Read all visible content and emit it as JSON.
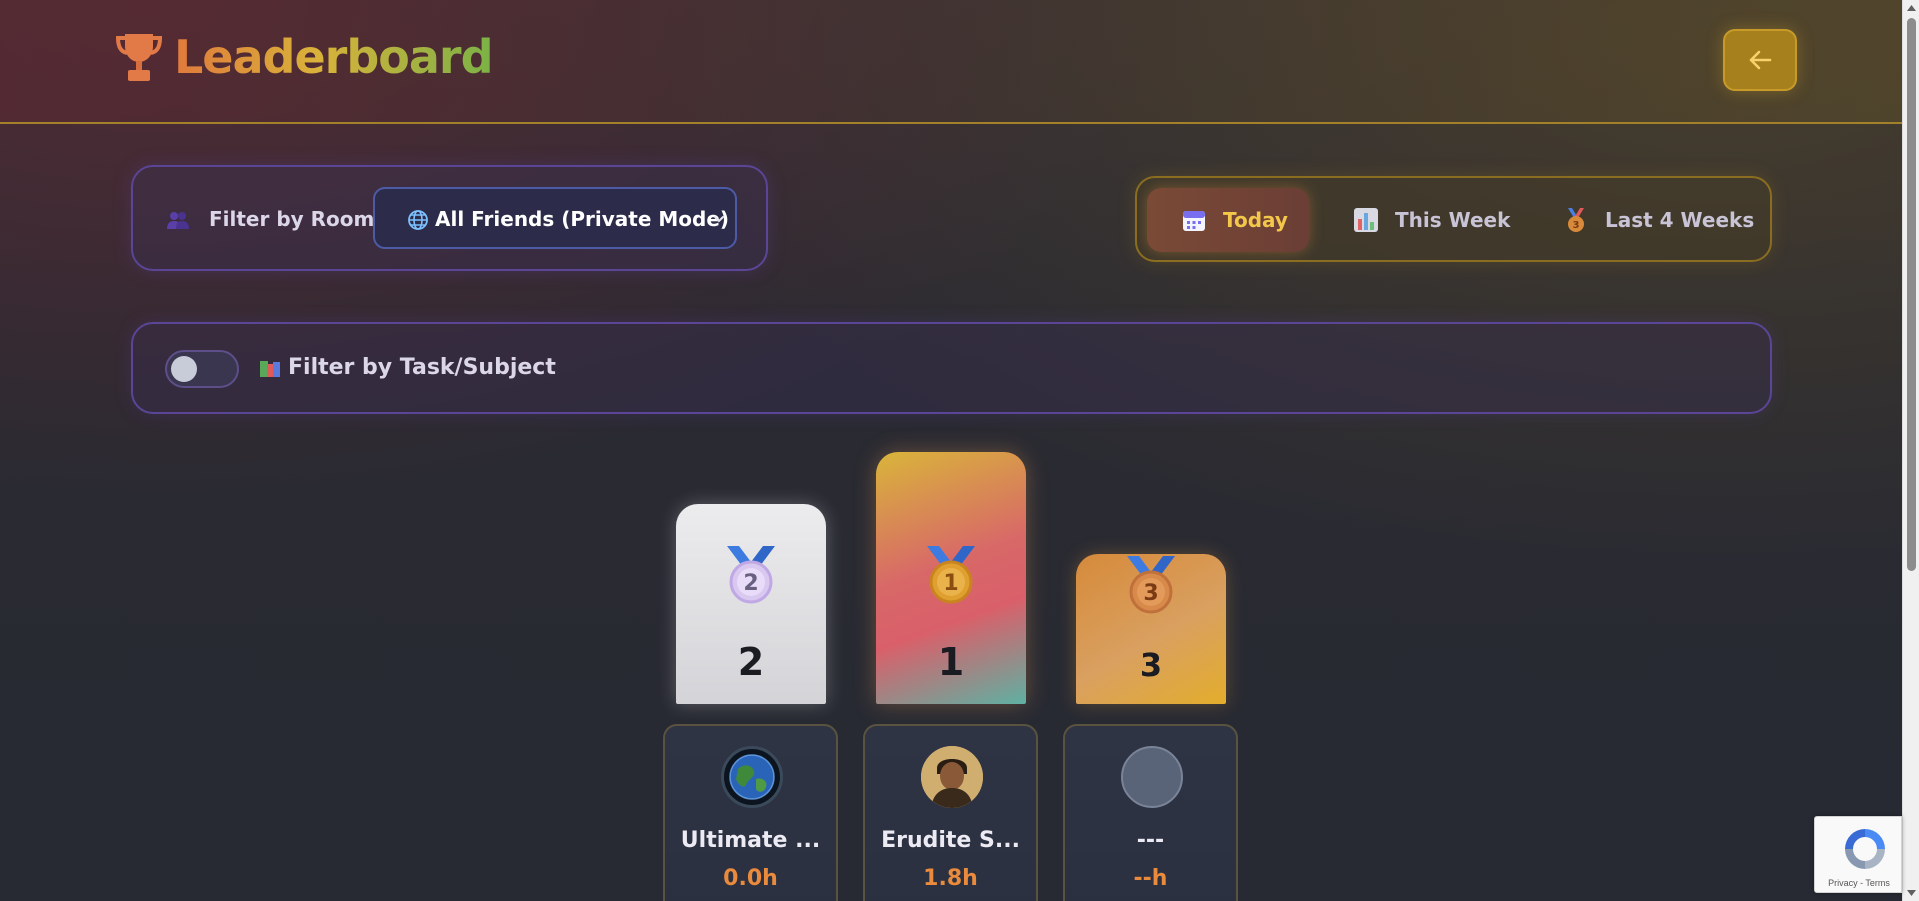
{
  "header": {
    "title": "Leaderboard",
    "trophy_icon": "trophy-icon",
    "back_icon": "arrow-left-icon"
  },
  "room_filter": {
    "label": "Filter by Room:",
    "selected": "All Friends (Private Mode)"
  },
  "period_tabs": [
    {
      "label": "Today",
      "icon": "calendar-icon",
      "active": true
    },
    {
      "label": "This Week",
      "icon": "bar-chart-icon",
      "active": false
    },
    {
      "label": "Last 4 Weeks",
      "icon": "medal-icon",
      "active": false
    }
  ],
  "task_filter": {
    "label": "Filter by Task/Subject",
    "enabled": false
  },
  "podium": [
    {
      "rank": "2",
      "medal_label": "2"
    },
    {
      "rank": "1",
      "medal_label": "1"
    },
    {
      "rank": "3",
      "medal_label": "3"
    }
  ],
  "players": [
    {
      "name": "Ultimate ...",
      "hours": "0.0h",
      "avatar": "earth-avatar"
    },
    {
      "name": "Erudite S...",
      "hours": "1.8h",
      "avatar": "portrait-avatar"
    },
    {
      "name": "---",
      "hours": "--h",
      "avatar": "empty-avatar"
    }
  ],
  "recaptcha": {
    "text": "Privacy - Terms"
  },
  "colors": {
    "accent_gold": "#f2c74a",
    "accent_orange": "#e98a3c",
    "panel_border_purple": "#5b4596",
    "tab_border_gold": "#8a6d20"
  }
}
